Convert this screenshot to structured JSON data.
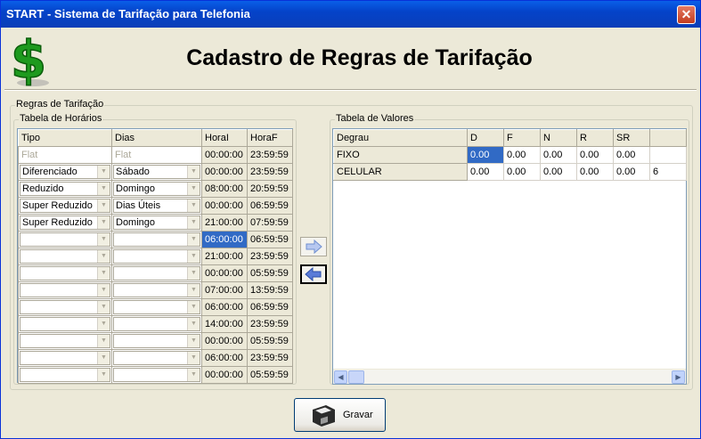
{
  "window": {
    "title": "START - Sistema de Tarifação para Telefonia",
    "close": "✕"
  },
  "page": {
    "title": "Cadastro de Regras de Tarifação"
  },
  "groups": {
    "rules": "Regras de Tarifação",
    "horarios": "Tabela de Horários",
    "valores": "Tabela de Valores"
  },
  "horarios": {
    "headers": [
      "Tipo",
      "Dias",
      "HoraI",
      "HoraF"
    ],
    "rows": [
      {
        "tipo": "Flat",
        "dias": "Flat",
        "horai": "00:00:00",
        "horaf": "23:59:59"
      },
      {
        "tipo": "Diferenciado",
        "dias": "Sábado",
        "horai": "00:00:00",
        "horaf": "23:59:59"
      },
      {
        "tipo": "Reduzido",
        "dias": "Domingo",
        "horai": "08:00:00",
        "horaf": "20:59:59"
      },
      {
        "tipo": "Super Reduzido",
        "dias": "Dias Úteis",
        "horai": "00:00:00",
        "horaf": "06:59:59"
      },
      {
        "tipo": "Super Reduzido",
        "dias": "Domingo",
        "horai": "21:00:00",
        "horaf": "07:59:59"
      },
      {
        "tipo": "",
        "dias": "",
        "horai": "06:00:00",
        "horaf": "06:59:59"
      },
      {
        "tipo": "",
        "dias": "",
        "horai": "21:00:00",
        "horaf": "23:59:59"
      },
      {
        "tipo": "",
        "dias": "",
        "horai": "00:00:00",
        "horaf": "05:59:59"
      },
      {
        "tipo": "",
        "dias": "",
        "horai": "07:00:00",
        "horaf": "13:59:59"
      },
      {
        "tipo": "",
        "dias": "",
        "horai": "06:00:00",
        "horaf": "06:59:59"
      },
      {
        "tipo": "",
        "dias": "",
        "horai": "14:00:00",
        "horaf": "23:59:59"
      },
      {
        "tipo": "",
        "dias": "",
        "horai": "00:00:00",
        "horaf": "05:59:59"
      },
      {
        "tipo": "",
        "dias": "",
        "horai": "06:00:00",
        "horaf": "23:59:59"
      },
      {
        "tipo": "",
        "dias": "",
        "horai": "00:00:00",
        "horaf": "05:59:59"
      }
    ]
  },
  "valores": {
    "headers": [
      "Degrau",
      "D",
      "F",
      "N",
      "R",
      "SR",
      ""
    ],
    "rows": [
      [
        "FIXO",
        "0.00",
        "0.00",
        "0.00",
        "0.00",
        "0.00",
        ""
      ],
      [
        "CELULAR",
        "0.00",
        "0.00",
        "0.00",
        "0.00",
        "0.00",
        "6"
      ]
    ]
  },
  "buttons": {
    "gravar": "Gravar"
  },
  "colors": {
    "titlebar": "#0A5FE8",
    "selection": "#316AC5",
    "dollar": "#1E9A1E"
  }
}
